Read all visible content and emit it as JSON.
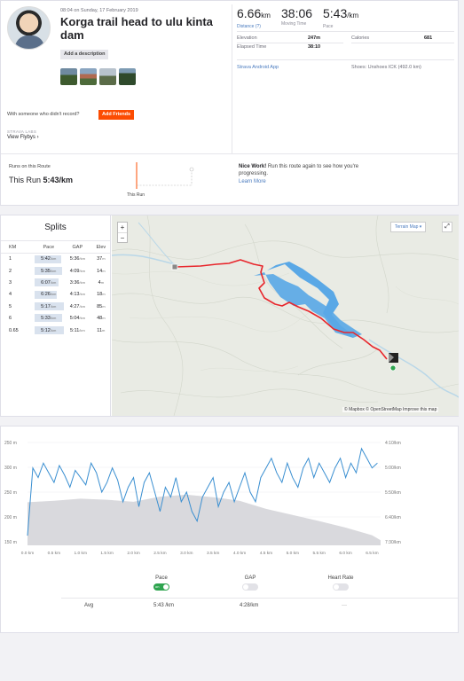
{
  "activity": {
    "date": "08:04 on Sunday, 17 February 2019",
    "title": "Korga trail head to ulu kinta dam",
    "add_description": "Add a description",
    "with_someone": "With someone who didn't record?",
    "add_friends": "Add Friends",
    "labs": "STRAVA LABS",
    "view_flybys": "View Flybys",
    "view_flybys_arrow": "›"
  },
  "stats": {
    "distance": {
      "value": "6.66",
      "unit": "km",
      "label": "Distance (?)"
    },
    "moving_time": {
      "value": "38:06",
      "label": "Moving Time"
    },
    "pace": {
      "value": "5:43",
      "unit": "/km",
      "label": "Pace"
    },
    "elevation": {
      "label": "Elevation",
      "value": "247m"
    },
    "calories": {
      "label": "Calories",
      "value": "681"
    },
    "elapsed_time": {
      "label": "Elapsed Time",
      "value": "38:10"
    },
    "app": "Strava Android App",
    "shoes": "Shoes: Unshoes ICK (492.0 km)"
  },
  "route": {
    "label": "Runs on this Route",
    "this_run_prefix": "This Run",
    "this_run_value": "5:43/km",
    "chart_label": "This Run",
    "nice_title": "Nice Work!",
    "nice_text": "Run this route again to see how you're progressing.",
    "learn_more": "Learn More"
  },
  "splits": {
    "title": "Splits",
    "headers": [
      "KM",
      "Pace",
      "GAP",
      "Elev"
    ],
    "rows": [
      {
        "km": "1",
        "pace": "5:42",
        "pace_unit": "/km",
        "gap": "5:36",
        "gap_unit": "/km",
        "elev": "37",
        "elev_unit": "m",
        "pace_frac": 0.86
      },
      {
        "km": "2",
        "pace": "5:35",
        "pace_unit": "/km",
        "gap": "4:09",
        "gap_unit": "/km",
        "elev": "14",
        "elev_unit": "m",
        "pace_frac": 0.89
      },
      {
        "km": "3",
        "pace": "6:07",
        "pace_unit": "/km",
        "gap": "3:36",
        "gap_unit": "/km",
        "elev": "4",
        "elev_unit": "m",
        "pace_frac": 0.78
      },
      {
        "km": "4",
        "pace": "6:26",
        "pace_unit": "/km",
        "gap": "4:13",
        "gap_unit": "/km",
        "elev": "18",
        "elev_unit": "m",
        "pace_frac": 0.72
      },
      {
        "km": "5",
        "pace": "5:17",
        "pace_unit": "/km",
        "gap": "4:27",
        "gap_unit": "/km",
        "elev": "85",
        "elev_unit": "m",
        "pace_frac": 0.95
      },
      {
        "km": "6",
        "pace": "5:33",
        "pace_unit": "/km",
        "gap": "5:04",
        "gap_unit": "/km",
        "elev": "48",
        "elev_unit": "m",
        "pace_frac": 0.9
      },
      {
        "km": "0.65",
        "pace": "5:12",
        "pace_unit": "/km",
        "gap": "5:11",
        "gap_unit": "/km",
        "elev": "11",
        "elev_unit": "m",
        "pace_frac": 0.97
      }
    ]
  },
  "map": {
    "zoom_in": "+",
    "zoom_out": "−",
    "map_type": "Terrain Map ▾",
    "fullscreen": "⤢",
    "attribution": "© Mapbox © OpenStreetMap Improve this map"
  },
  "legend": {
    "pace": {
      "label": "Pace",
      "state": "on"
    },
    "gap": {
      "label": "GAP"
    },
    "heart_rate": {
      "label": "Heart Rate"
    },
    "avg_label": "Avg",
    "avg_pace": "5:43 /km",
    "avg_gap": "4:28/km",
    "avg_hr": "—"
  },
  "colors": {
    "accent": "#fc4c02",
    "pace_line": "#3a8fd1",
    "elevation_fill": "#d9d9dd",
    "route": "#e8262c",
    "water": "#5aa8e6",
    "toggle_on": "#2ea44f"
  },
  "chart_data": {
    "type": "area",
    "x_unit": "km",
    "x_ticks": [
      "0.0 km",
      "0.5 km",
      "1.0 km",
      "1.5 km",
      "2.0 km",
      "2.5 km",
      "3.0 km",
      "3.5 km",
      "4.0 km",
      "4.5 km",
      "5.0 km",
      "5.5 km",
      "6.0 km",
      "6.5 km"
    ],
    "xlim": [
      0,
      6.66
    ],
    "left_axis": {
      "ticks": [
        "250 m",
        "300 m",
        "250 m",
        "200 m",
        "150 m"
      ],
      "ylim": [
        140,
        350
      ],
      "tick_values": [
        350,
        300,
        250,
        200,
        150
      ]
    },
    "right_axis": {
      "ticks": [
        "4:10/km",
        "5:00/km",
        "5:50/km",
        "6:40/km",
        "7:30/km"
      ]
    },
    "series": [
      {
        "name": "Pace",
        "x": [
          0.0,
          0.1,
          0.2,
          0.3,
          0.4,
          0.5,
          0.6,
          0.7,
          0.8,
          0.9,
          1.0,
          1.1,
          1.2,
          1.3,
          1.4,
          1.5,
          1.6,
          1.7,
          1.8,
          1.9,
          2.0,
          2.1,
          2.2,
          2.3,
          2.4,
          2.5,
          2.6,
          2.7,
          2.8,
          2.9,
          3.0,
          3.1,
          3.2,
          3.3,
          3.4,
          3.5,
          3.6,
          3.7,
          3.8,
          3.9,
          4.0,
          4.1,
          4.2,
          4.3,
          4.4,
          4.5,
          4.6,
          4.7,
          4.8,
          4.9,
          5.0,
          5.1,
          5.2,
          5.3,
          5.4,
          5.5,
          5.6,
          5.7,
          5.8,
          5.9,
          6.0,
          6.1,
          6.2,
          6.3,
          6.4,
          6.5,
          6.6
        ],
        "y_pace_sec_per_km": [
          450,
          310,
          330,
          300,
          320,
          340,
          305,
          325,
          350,
          315,
          330,
          345,
          300,
          320,
          360,
          340,
          310,
          335,
          380,
          350,
          330,
          390,
          340,
          320,
          360,
          400,
          350,
          370,
          330,
          380,
          360,
          400,
          420,
          370,
          350,
          330,
          390,
          360,
          340,
          380,
          350,
          320,
          360,
          380,
          330,
          310,
          290,
          320,
          340,
          300,
          330,
          350,
          310,
          290,
          330,
          300,
          320,
          340,
          310,
          290,
          330,
          300,
          320,
          270,
          290,
          310,
          300
        ]
      },
      {
        "name": "Elevation",
        "x": [
          0.0,
          0.5,
          1.0,
          1.5,
          2.0,
          2.5,
          3.0,
          3.5,
          4.0,
          4.5,
          5.0,
          5.5,
          6.0,
          6.5,
          6.66
        ],
        "y_m": [
          225,
          228,
          232,
          230,
          226,
          236,
          240,
          235,
          228,
          212,
          200,
          188,
          175,
          160,
          150
        ]
      }
    ]
  }
}
